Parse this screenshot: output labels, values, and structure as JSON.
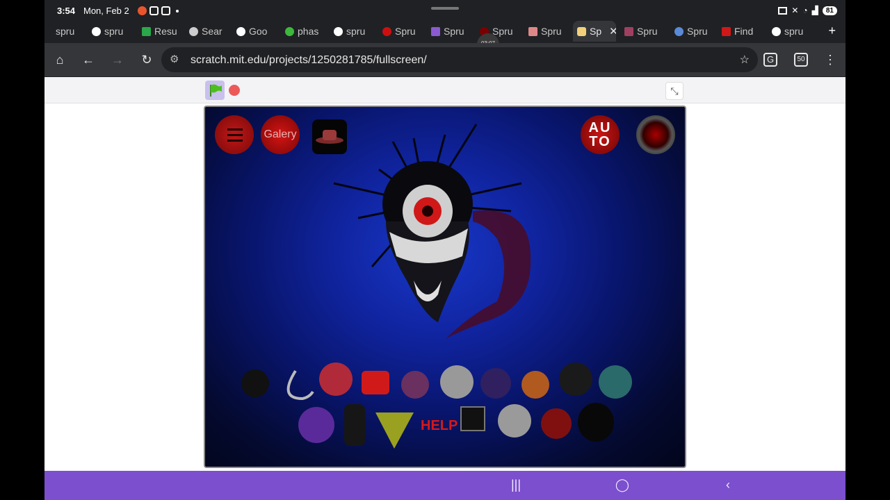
{
  "status_bar": {
    "time": "3:54",
    "date": "Mon, Feb 2",
    "battery": "81"
  },
  "tabs": [
    {
      "label": "spru"
    },
    {
      "label": "spru"
    },
    {
      "label": "Resu"
    },
    {
      "label": "Sear"
    },
    {
      "label": "Goo"
    },
    {
      "label": "phas"
    },
    {
      "label": "spru"
    },
    {
      "label": "Spru"
    },
    {
      "label": "Spru"
    },
    {
      "label": "Spru"
    },
    {
      "label": "Spru"
    },
    {
      "label": "Sp"
    },
    {
      "label": "Spru"
    },
    {
      "label": "Spru"
    },
    {
      "label": "Find"
    },
    {
      "label": "spru"
    }
  ],
  "timer_bubble": "03:07",
  "toolbar": {
    "url": "scratch.mit.edu/projects/1250281785/fullscreen/",
    "tab_count": "50"
  },
  "stage": {
    "gallery_label": "Galery",
    "auto_label_line1": "AU",
    "auto_label_line2": "TO",
    "sign_text": "HELP"
  },
  "colors": {
    "navbar": "#7c4fce",
    "stage_blue": "#1838c8",
    "accent_red": "#c81414"
  }
}
